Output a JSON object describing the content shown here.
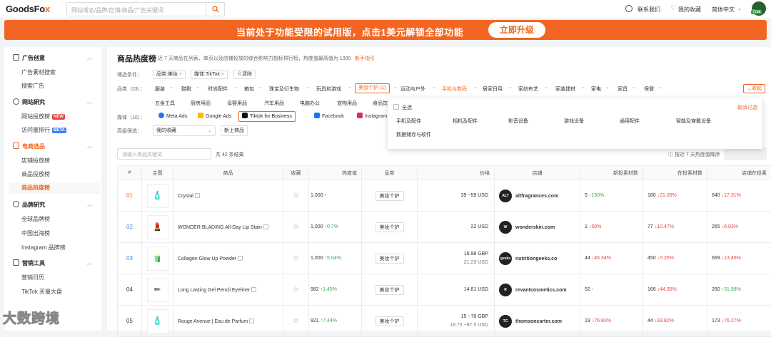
{
  "brand": {
    "name_prefix": "GoodsFo",
    "name_suffix": "x"
  },
  "search": {
    "placeholder": "网站域名/品牌/店铺/商品/广告关键词"
  },
  "topnav": {
    "contact": "联系我们",
    "favorites": "我的收藏",
    "language": "简体中文",
    "trial": "Trial"
  },
  "banner": {
    "text": "当前处于功能受限的试用版，点击1美元解锁全部功能",
    "button": "立即升级"
  },
  "sidebar": {
    "sections": [
      {
        "title": "广告创意",
        "items": [
          "广告素材搜索",
          "搜索广告"
        ]
      },
      {
        "title": "网站研究",
        "items": [
          "网站投放榜",
          "访问量排行"
        ],
        "tags": [
          "NEW",
          "BETA"
        ]
      },
      {
        "title": "电商选品",
        "items": [
          "店铺投放榜",
          "商品投放榜",
          "商品热度榜"
        ],
        "active": "商品热度榜"
      },
      {
        "title": "品牌研究",
        "items": [
          "全球品牌榜",
          "中国出海榜",
          "Instagram 品牌榜"
        ]
      },
      {
        "title": "营销工具",
        "items": [
          "营销日历",
          "TikTok 买量大盘"
        ]
      }
    ]
  },
  "page": {
    "title": "商品热度榜",
    "subtitle": "近 7 天商品在列表、单页以及店铺投放的综合影响力指标排行榜，热度值最高值为 1000",
    "guide": "新手指引"
  },
  "filters": {
    "conditions_label": "筛选条件：",
    "chips": [
      "品类:美妆",
      "媒体:TikTok"
    ],
    "clear": "清除",
    "category_label": "品类（23）：",
    "categories_row1": [
      "服装",
      "鞋靴",
      "时尚配件",
      "箱包",
      "珠宝及衍生物",
      "玩具和游戏",
      "美妆个护 (1)",
      "运动与户外",
      "手机与数码",
      "居家日用",
      "家纺布艺",
      "家装建材",
      "家电",
      "家具",
      "保健"
    ],
    "categories_row2": [
      "五金工具",
      "厨房用品",
      "母婴用品",
      "汽车用品",
      "电脑办公",
      "宠物用品",
      "食品饮料"
    ],
    "collapse": "收起",
    "media_label": "媒体（10）：",
    "media": [
      "Meta Ads",
      "Google Ads",
      "Tiktok for Business",
      "Facebook",
      "Instagram"
    ],
    "advanced_label": "高级筛选：",
    "my_favorites": "我的收藏",
    "new_products": "新上商品"
  },
  "dropdown": {
    "select_all": "全选",
    "cancel": "取消已选",
    "options": [
      "手机及配件",
      "相机及配件",
      "影音设备",
      "游戏设备",
      "通用配件",
      "智能及穿戴设备",
      "数据储存与软件"
    ]
  },
  "table_controls": {
    "search_placeholder": "请输入商品关键词",
    "count": "共 42 条结果",
    "sort": "按近 7 天热度值降序"
  },
  "table": {
    "headers": [
      "#",
      "主图",
      "商品",
      "收藏",
      "热度值",
      "品类",
      "价格",
      "店铺",
      "新投素材数",
      "在投素材数",
      "店铺在投素"
    ],
    "rows": [
      {
        "rank": "01",
        "name": "Crystal",
        "heat": "1,000",
        "heat_change": "-",
        "category": "美妆个护",
        "price": [
          "39 ~59 USD"
        ],
        "store": "altfragrances.com",
        "store_logo": "ALT",
        "new_ads": "5",
        "new_ads_change": "150%",
        "new_dir": "up",
        "live_ads": "180",
        "live_change": "21.05%",
        "live_dir": "dn",
        "store_ads": "640",
        "store_change": "17.31%",
        "store_dir": "dn",
        "thumb": "🧴"
      },
      {
        "rank": "02",
        "name": "WONDER BLADING All-Day Lip Stain",
        "heat": "1,000",
        "heat_change": "0.7%",
        "category": "美妆个护",
        "price": [
          "22 USD"
        ],
        "store": "wonderskin.com",
        "store_logo": "W",
        "new_ads": "1",
        "new_ads_change": "50%",
        "new_dir": "dn",
        "live_ads": "77",
        "live_change": "10.47%",
        "live_dir": "dn",
        "store_ads": "265",
        "store_change": "6.03%",
        "store_dir": "dn",
        "thumb": "💄"
      },
      {
        "rank": "03",
        "name": "Collagen Glow Up Powder",
        "heat": "1,000",
        "heat_change": "5.04%",
        "category": "美妆个护",
        "price": [
          "16.98 GBP",
          "21.23 USD"
        ],
        "store": "nutritiongeeks.co",
        "store_logo": "geeks",
        "new_ads": "44",
        "new_ads_change": "46.34%",
        "new_dir": "dn",
        "live_ads": "450",
        "live_change": "5.26%",
        "live_dir": "dn",
        "store_ads": "669",
        "store_change": "13.45%",
        "store_dir": "dn",
        "thumb": "🧃"
      },
      {
        "rank": "04",
        "name": "Long Lasting Gel Pencil Eyeliner",
        "heat": "982",
        "heat_change": "1.45%",
        "category": "美妆个护",
        "price": [
          "14.81 USD"
        ],
        "store": "revantcosmetics.com",
        "store_logo": "R",
        "new_ads": "52",
        "new_ads_change": "-",
        "new_dir": "",
        "live_ads": "166",
        "live_change": "44.35%",
        "live_dir": "dn",
        "store_ads": "260",
        "store_change": "31.98%",
        "store_dir": "up",
        "thumb": "✏"
      },
      {
        "rank": "05",
        "name": "Rouge Avenue | Eau de Parfum",
        "heat": "921",
        "heat_change": "7.44%",
        "category": "美妆个护",
        "price": [
          "15 ~78 GBP",
          "18.75 ~97.5 USD"
        ],
        "store": "thomsoncarter.com",
        "store_logo": "TC",
        "new_ads": "19",
        "new_ads_change": "76.83%",
        "new_dir": "dn",
        "live_ads": "44",
        "live_change": "83.82%",
        "live_dir": "dn",
        "store_ads": "173",
        "store_change": "76.27%",
        "store_dir": "dn",
        "thumb": "🧴"
      }
    ]
  },
  "watermark": "大数跨境",
  "colors": {
    "accent": "#f26522",
    "up": "#3aa655",
    "down": "#e54545"
  }
}
